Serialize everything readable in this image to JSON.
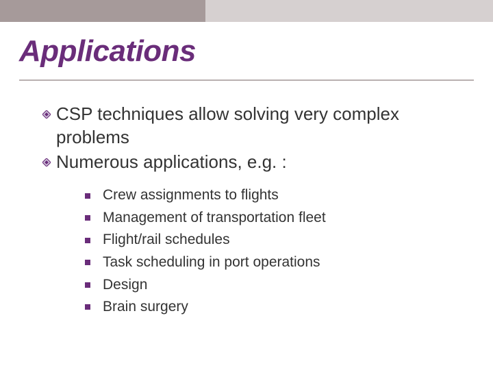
{
  "slide": {
    "title": "Applications",
    "bullets": [
      {
        "text": "CSP techniques allow solving very complex problems"
      },
      {
        "text": "Numerous applications, e.g. :"
      }
    ],
    "sub_bullets": [
      "Crew assignments to flights",
      "Management of transportation fleet",
      "Flight/rail schedules",
      "Task scheduling in port operations",
      "Design",
      "Brain surgery"
    ]
  },
  "theme": {
    "accent": "#6a2d7a",
    "band_dark": "#a69a9a",
    "band_light": "#d6d0d0"
  }
}
